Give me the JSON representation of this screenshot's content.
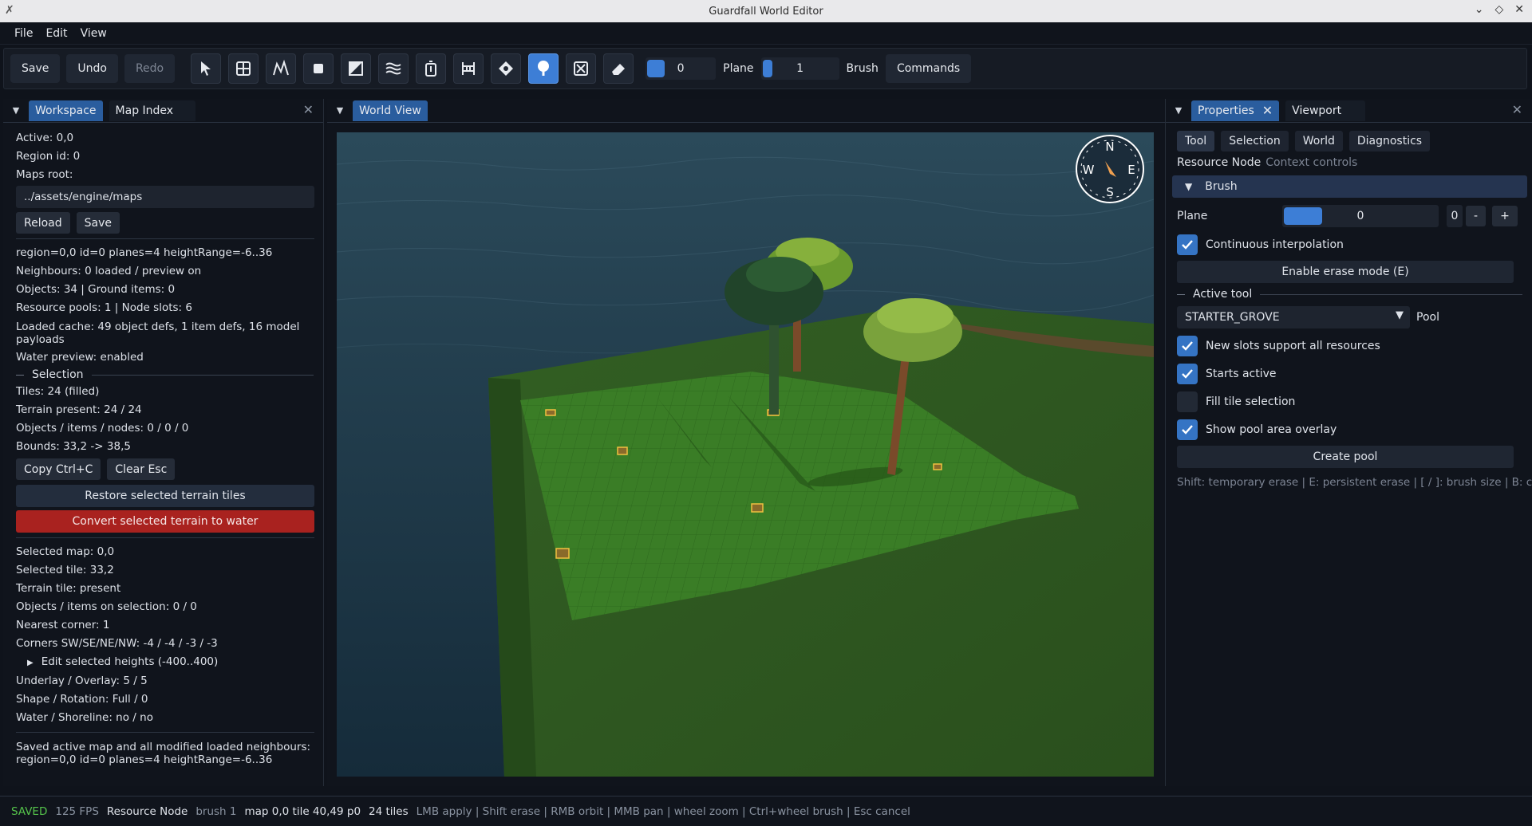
{
  "window": {
    "title": "Guardfall World Editor"
  },
  "menu": [
    "File",
    "Edit",
    "View"
  ],
  "toolbar": {
    "save": "Save",
    "undo": "Undo",
    "redo": "Redo",
    "plane_label": "Plane",
    "brush_label": "Brush",
    "commands": "Commands",
    "value_a": "0",
    "value_b": "1",
    "tools": [
      "select-tool",
      "tile-grid-tool",
      "heightmap-tool",
      "fill-tool",
      "shape-tool",
      "water-tool",
      "object-tool",
      "fence-tool",
      "marker-tool",
      "resource-node-tool",
      "erase-box-tool",
      "eraser-tool"
    ],
    "active_tool": "resource-node-tool"
  },
  "left": {
    "tabs": [
      "Workspace",
      "Map Index"
    ],
    "active": "Active: 0,0",
    "region": "Region id: 0",
    "maps_root_label": "Maps root:",
    "maps_root": "../assets/engine/maps",
    "reload": "Reload",
    "save": "Save",
    "info": [
      "region=0,0 id=0 planes=4 heightRange=-6..36",
      "Neighbours: 0 loaded / preview on",
      "Objects: 34 | Ground items: 0",
      "Resource pools: 1 | Node slots: 6"
    ],
    "cache": "Loaded cache: 49 object defs, 1 item defs, 16 model payloads",
    "water_preview": "Water preview: enabled",
    "selection_title": "Selection",
    "selection_info": [
      "Tiles: 24 (filled)",
      "Terrain present: 24 / 24",
      "Objects / items / nodes: 0 / 0 / 0",
      "Bounds: 33,2 -> 38,5"
    ],
    "copy": "Copy  Ctrl+C",
    "clear": "Clear  Esc",
    "restore": "Restore selected terrain tiles",
    "convert": "Convert selected terrain to water",
    "tile_info": [
      "Selected map: 0,0",
      "Selected tile: 33,2",
      "Terrain tile: present",
      "Objects / items on selection: 0 / 0",
      "Nearest corner: 1",
      "Corners SW/SE/NE/NW: -4 / -4 / -3 / -3"
    ],
    "edit_heights": "Edit selected heights (-400..400)",
    "tile_info2": [
      "Underlay / Overlay: 5 / 5",
      "Shape / Rotation: Full / 0",
      "Water / Shoreline: no / no"
    ],
    "saved_msg": "Saved active map and all modified loaded neighbours: region=0,0 id=0 planes=4 heightRange=-6..36"
  },
  "mid": {
    "tab": "World View"
  },
  "compass": {
    "n": "N",
    "s": "S",
    "e": "E",
    "w": "W"
  },
  "right": {
    "tabs": [
      "Properties",
      "Viewport"
    ],
    "subtabs": [
      "Tool",
      "Selection",
      "World",
      "Diagnostics"
    ],
    "resource_node": "Resource Node",
    "context": "Context controls",
    "brush": "Brush",
    "plane_label": "Plane",
    "plane_value": "0",
    "plane_num": "0",
    "minus": "-",
    "plus": "+",
    "continuous": "Continuous interpolation",
    "erase_mode": "Enable erase mode (E)",
    "active_tool": "Active tool",
    "pool_value": "STARTER_GROVE",
    "pool_label": "Pool",
    "checks": [
      {
        "label": "New slots support all resources",
        "on": true
      },
      {
        "label": "Starts active",
        "on": true
      },
      {
        "label": "Fill tile selection",
        "on": false
      },
      {
        "label": "Show pool area overlay",
        "on": true
      }
    ],
    "create_pool": "Create pool",
    "hint": "Shift: temporary erase | E: persistent erase | [ / ]: brush size | B: contin"
  },
  "status": {
    "saved": "SAVED",
    "fps": "125 FPS",
    "tool": "Resource Node",
    "brush": "brush 1",
    "loc": "map 0,0  tile 40,49  p0",
    "tiles": "24 tiles",
    "help": "LMB apply | Shift erase | RMB orbit | MMB pan | wheel zoom | Ctrl+wheel brush | Esc cancel"
  },
  "colors": {
    "accent": "#3d7ed6",
    "danger": "#a9221f",
    "ok": "#55c44b",
    "water": "#1d3a4c",
    "grass": "#3f7d2a"
  }
}
